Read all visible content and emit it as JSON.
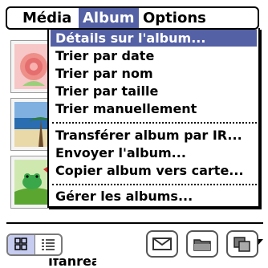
{
  "menubar": {
    "items": [
      {
        "label": "Média"
      },
      {
        "label": "Album"
      },
      {
        "label": "Options"
      }
    ]
  },
  "album_menu": {
    "groups": [
      [
        "Détails sur l'album...",
        "Trier par date",
        "Trier par nom",
        "Trier par taille",
        "Trier manuellement"
      ],
      [
        "Transférer album par IR...",
        "Envoyer l'album...",
        "Copier album vers carte..."
      ],
      [
        "Gérer les albums..."
      ]
    ]
  },
  "thumbnails": [
    {
      "icon": "rose-photo-icon"
    },
    {
      "icon": "beach-photo-icon"
    },
    {
      "icon": "frog-photo-icon"
    }
  ],
  "bottom_bar": {
    "view_toggle": {
      "thumbnail_icon": "thumbnail-view-icon",
      "list_icon": "list-view-icon"
    },
    "buttons": [
      {
        "icon": "envelope-icon"
      },
      {
        "icon": "folder-icon"
      },
      {
        "icon": "copy-icon"
      }
    ],
    "cut_text": "Ifanrea"
  },
  "colors": {
    "highlight": "#5561a5",
    "toggle_selected": "#c6ccef"
  }
}
